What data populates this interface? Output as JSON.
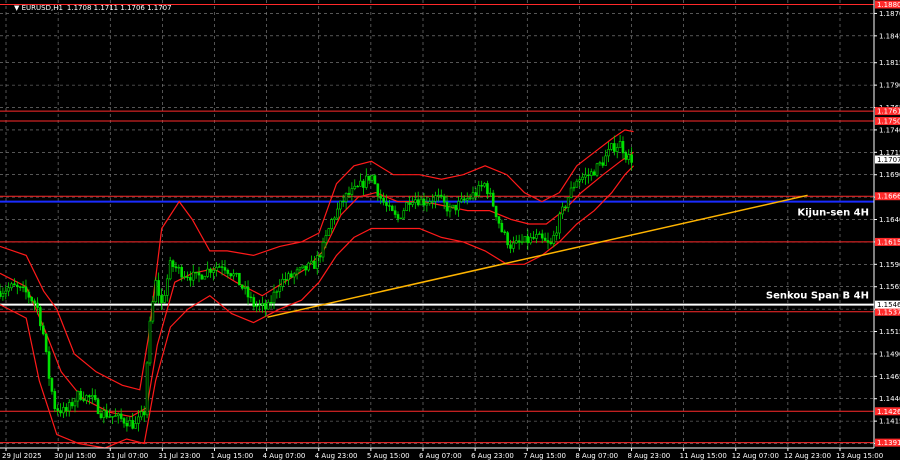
{
  "header": {
    "symbol": "EURUSD,H1",
    "ohlc": "1.1708 1.1711 1.1706 1.1707"
  },
  "colors": {
    "background": "#000000",
    "grid": "#8a8a8a",
    "candle_up": "#00e000",
    "candle_down": "#00e000",
    "bands": "#ff1a1a",
    "support_resistance": "#ff2a2a",
    "kijun": "#1a2cff",
    "senkou": "#ffffff",
    "trendline": "#ffb400",
    "price_label_bg": "#ff2a2a",
    "current_price_bg": "#ffffff"
  },
  "chart_data": {
    "type": "candlestick",
    "symbol": "EURUSD",
    "timeframe": "H1",
    "ylim": [
      1.1385,
      1.1885
    ],
    "grid": true,
    "y_ticks": [
      "1.1870",
      "1.1845",
      "1.1815",
      "1.1790",
      "1.1765",
      "1.1740",
      "1.1715",
      "1.1690",
      "1.1665",
      "1.1640",
      "1.1615",
      "1.1590",
      "1.1565",
      "1.1540",
      "1.1515",
      "1.1490",
      "1.1465",
      "1.1440",
      "1.1415",
      "1.1390"
    ],
    "x_ticks": [
      "29 Jul 2025",
      "30 Jul 15:00",
      "31 Jul 07:00",
      "31 Jul 23:00",
      "1 Aug 15:00",
      "4 Aug 07:00",
      "4 Aug 23:00",
      "5 Aug 15:00",
      "6 Aug 07:00",
      "6 Aug 23:00",
      "7 Aug 15:00",
      "8 Aug 07:00",
      "8 Aug 23:00",
      "11 Aug 15:00",
      "12 Aug 07:00",
      "12 Aug 23:00",
      "13 Aug 15:00"
    ],
    "levels": [
      {
        "value": 1.188,
        "label": "1.1880"
      },
      {
        "value": 1.1761,
        "label": "1.1761"
      },
      {
        "value": 1.175,
        "label": "1.1750"
      },
      {
        "value": 1.1666,
        "label": "1.1666"
      },
      {
        "value": 1.1615,
        "label": "1.1615"
      },
      {
        "value": 1.1537,
        "label": "1.1537"
      },
      {
        "value": 1.1426,
        "label": "1.1426"
      },
      {
        "value": 1.1391,
        "label": "1.1391"
      }
    ],
    "kijun": {
      "value": 1.166,
      "label": "Kijun-sen 4H"
    },
    "senkou": {
      "value": 1.1545,
      "label": "Senkou Span B 4H",
      "tag": "1.1546"
    },
    "current_price": "1.1707",
    "trendline": {
      "start": {
        "x": 0.306,
        "y": 1.1531
      },
      "end": {
        "x": 0.924,
        "y": 1.1667
      }
    },
    "price_path": [
      [
        0.0,
        1.156
      ],
      [
        0.015,
        1.1565
      ],
      [
        0.03,
        1.1558
      ],
      [
        0.042,
        1.1545
      ],
      [
        0.05,
        1.151
      ],
      [
        0.055,
        1.147
      ],
      [
        0.063,
        1.143
      ],
      [
        0.075,
        1.1425
      ],
      [
        0.09,
        1.1445
      ],
      [
        0.105,
        1.144
      ],
      [
        0.115,
        1.1425
      ],
      [
        0.13,
        1.142
      ],
      [
        0.145,
        1.1415
      ],
      [
        0.155,
        1.141
      ],
      [
        0.165,
        1.1425
      ],
      [
        0.17,
        1.151
      ],
      [
        0.178,
        1.157
      ],
      [
        0.185,
        1.1545
      ],
      [
        0.195,
        1.159
      ],
      [
        0.21,
        1.158
      ],
      [
        0.225,
        1.1575
      ],
      [
        0.24,
        1.1585
      ],
      [
        0.255,
        1.159
      ],
      [
        0.27,
        1.1575
      ],
      [
        0.29,
        1.1545
      ],
      [
        0.306,
        1.154
      ],
      [
        0.32,
        1.157
      ],
      [
        0.34,
        1.158
      ],
      [
        0.36,
        1.159
      ],
      [
        0.37,
        1.161
      ],
      [
        0.38,
        1.164
      ],
      [
        0.395,
        1.1665
      ],
      [
        0.41,
        1.1675
      ],
      [
        0.425,
        1.169
      ],
      [
        0.435,
        1.1665
      ],
      [
        0.445,
        1.165
      ],
      [
        0.455,
        1.164
      ],
      [
        0.47,
        1.1665
      ],
      [
        0.485,
        1.166
      ],
      [
        0.5,
        1.1665
      ],
      [
        0.515,
        1.165
      ],
      [
        0.53,
        1.166
      ],
      [
        0.545,
        1.167
      ],
      [
        0.555,
        1.168
      ],
      [
        0.565,
        1.1655
      ],
      [
        0.575,
        1.1625
      ],
      [
        0.585,
        1.161
      ],
      [
        0.6,
        1.1615
      ],
      [
        0.615,
        1.162
      ],
      [
        0.63,
        1.161
      ],
      [
        0.64,
        1.164
      ],
      [
        0.65,
        1.1665
      ],
      [
        0.66,
        1.1685
      ],
      [
        0.675,
        1.169
      ],
      [
        0.69,
        1.1705
      ],
      [
        0.7,
        1.172
      ],
      [
        0.71,
        1.1725
      ],
      [
        0.717,
        1.171
      ],
      [
        0.725,
        1.1707
      ]
    ],
    "band_upper": [
      [
        0.0,
        1.161
      ],
      [
        0.03,
        1.16
      ],
      [
        0.05,
        1.156
      ],
      [
        0.065,
        1.154
      ],
      [
        0.085,
        1.149
      ],
      [
        0.11,
        1.147
      ],
      [
        0.14,
        1.1455
      ],
      [
        0.16,
        1.145
      ],
      [
        0.17,
        1.151
      ],
      [
        0.185,
        1.163
      ],
      [
        0.205,
        1.166
      ],
      [
        0.22,
        1.164
      ],
      [
        0.24,
        1.1605
      ],
      [
        0.26,
        1.1605
      ],
      [
        0.29,
        1.16
      ],
      [
        0.32,
        1.161
      ],
      [
        0.345,
        1.1615
      ],
      [
        0.365,
        1.1625
      ],
      [
        0.385,
        1.168
      ],
      [
        0.405,
        1.17
      ],
      [
        0.425,
        1.1705
      ],
      [
        0.45,
        1.169
      ],
      [
        0.48,
        1.169
      ],
      [
        0.505,
        1.1685
      ],
      [
        0.53,
        1.169
      ],
      [
        0.555,
        1.17
      ],
      [
        0.58,
        1.169
      ],
      [
        0.6,
        1.167
      ],
      [
        0.62,
        1.166
      ],
      [
        0.64,
        1.167
      ],
      [
        0.66,
        1.17
      ],
      [
        0.68,
        1.1715
      ],
      [
        0.7,
        1.173
      ],
      [
        0.715,
        1.174
      ],
      [
        0.725,
        1.1738
      ]
    ],
    "band_lower": [
      [
        0.0,
        1.1545
      ],
      [
        0.03,
        1.153
      ],
      [
        0.045,
        1.146
      ],
      [
        0.065,
        1.14
      ],
      [
        0.09,
        1.139
      ],
      [
        0.12,
        1.1385
      ],
      [
        0.145,
        1.1395
      ],
      [
        0.165,
        1.139
      ],
      [
        0.178,
        1.146
      ],
      [
        0.195,
        1.152
      ],
      [
        0.215,
        1.154
      ],
      [
        0.24,
        1.1555
      ],
      [
        0.265,
        1.1535
      ],
      [
        0.29,
        1.1525
      ],
      [
        0.32,
        1.154
      ],
      [
        0.345,
        1.155
      ],
      [
        0.365,
        1.157
      ],
      [
        0.385,
        1.16
      ],
      [
        0.405,
        1.162
      ],
      [
        0.425,
        1.163
      ],
      [
        0.45,
        1.163
      ],
      [
        0.48,
        1.163
      ],
      [
        0.505,
        1.162
      ],
      [
        0.53,
        1.1615
      ],
      [
        0.555,
        1.1605
      ],
      [
        0.58,
        1.159
      ],
      [
        0.6,
        1.159
      ],
      [
        0.62,
        1.16
      ],
      [
        0.64,
        1.1615
      ],
      [
        0.66,
        1.1635
      ],
      [
        0.68,
        1.165
      ],
      [
        0.7,
        1.167
      ],
      [
        0.715,
        1.169
      ],
      [
        0.725,
        1.17
      ]
    ],
    "band_mid": [
      [
        0.0,
        1.158
      ],
      [
        0.03,
        1.1565
      ],
      [
        0.05,
        1.152
      ],
      [
        0.07,
        1.147
      ],
      [
        0.095,
        1.144
      ],
      [
        0.125,
        1.1425
      ],
      [
        0.15,
        1.142
      ],
      [
        0.168,
        1.143
      ],
      [
        0.18,
        1.15
      ],
      [
        0.2,
        1.157
      ],
      [
        0.22,
        1.158
      ],
      [
        0.245,
        1.1585
      ],
      [
        0.27,
        1.157
      ],
      [
        0.3,
        1.1555
      ],
      [
        0.325,
        1.157
      ],
      [
        0.35,
        1.1585
      ],
      [
        0.37,
        1.1605
      ],
      [
        0.39,
        1.1645
      ],
      [
        0.41,
        1.1665
      ],
      [
        0.43,
        1.167
      ],
      [
        0.455,
        1.166
      ],
      [
        0.485,
        1.166
      ],
      [
        0.51,
        1.1655
      ],
      [
        0.535,
        1.165
      ],
      [
        0.56,
        1.165
      ],
      [
        0.585,
        1.164
      ],
      [
        0.605,
        1.1635
      ],
      [
        0.625,
        1.1635
      ],
      [
        0.645,
        1.165
      ],
      [
        0.665,
        1.167
      ],
      [
        0.69,
        1.169
      ],
      [
        0.71,
        1.1705
      ],
      [
        0.725,
        1.1715
      ]
    ]
  }
}
